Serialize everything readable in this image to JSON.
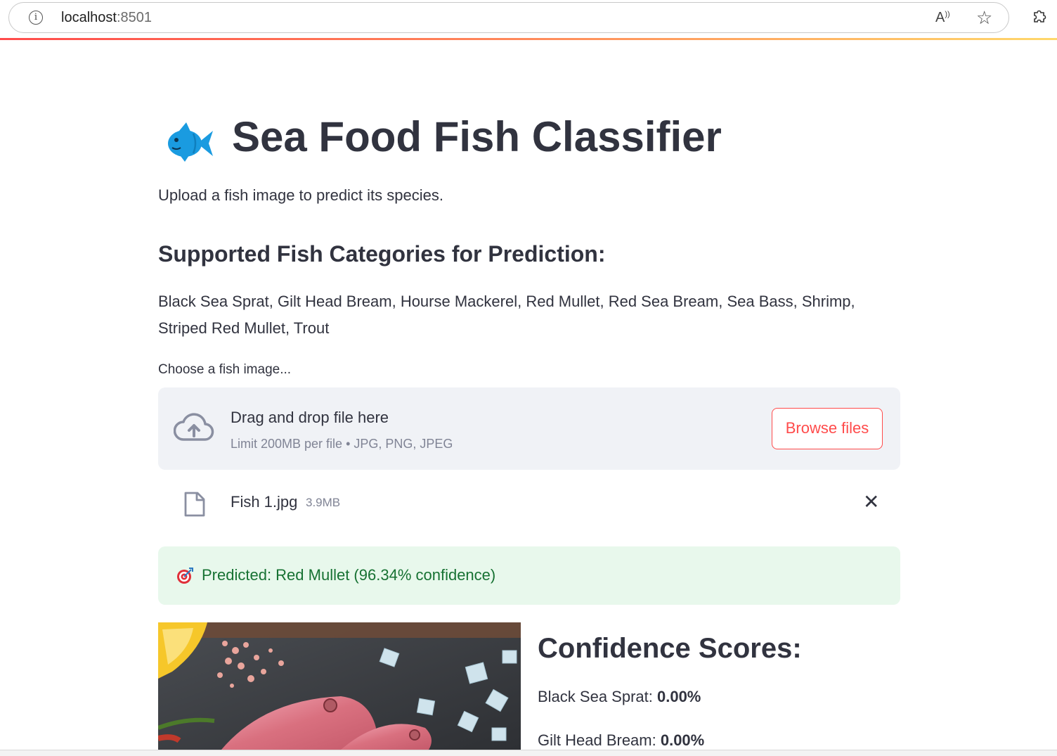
{
  "browser": {
    "url_host": "localhost",
    "url_port": ":8501",
    "read_aloud_icon": "read-aloud-icon",
    "favorite_icon": "star-icon",
    "extensions_icon": "puzzle-icon"
  },
  "app": {
    "title": "Sea Food Fish Classifier",
    "title_icon": "fish-icon",
    "subtitle": "Upload a fish image to predict its species.",
    "categories_heading": "Supported Fish Categories for Prediction:",
    "categories_text": "Black Sea Sprat, Gilt Head Bream, Hourse Mackerel, Red Mullet, Red Sea Bream, Sea Bass, Shrimp, Striped Red Mullet, Trout"
  },
  "uploader": {
    "label": "Choose a fish image...",
    "drag_text": "Drag and drop file here",
    "limit_text": "Limit 200MB per file • JPG, PNG, JPEG",
    "browse_label": "Browse files"
  },
  "file": {
    "name": "Fish 1.jpg",
    "size": "3.9MB"
  },
  "prediction": {
    "text": "Predicted: Red Mullet (96.34% confidence)"
  },
  "confidence": {
    "heading": "Confidence Scores:",
    "scores": [
      {
        "label": "Black Sea Sprat: ",
        "value": "0.00%"
      },
      {
        "label": "Gilt Head Bream: ",
        "value": "0.00%"
      }
    ]
  },
  "colors": {
    "accent": "#ff4b4b",
    "success_bg": "#e8f8ec",
    "success_text": "#177233",
    "uploader_bg": "#f0f2f6",
    "text": "#31333f"
  }
}
